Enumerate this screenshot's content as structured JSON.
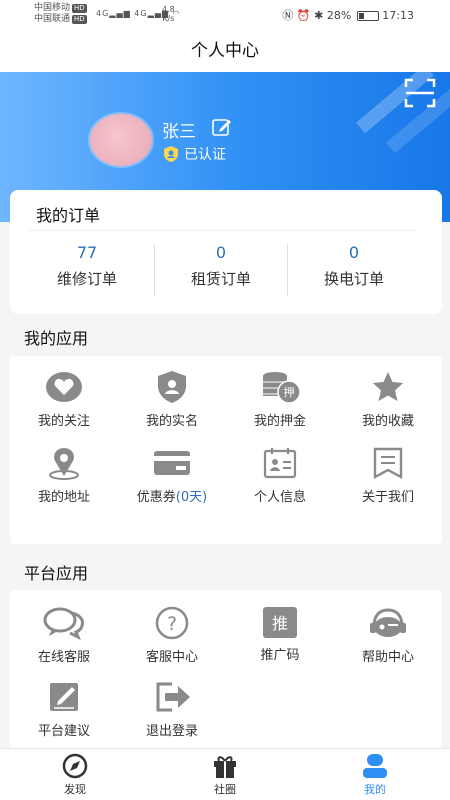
{
  "status_bar": {
    "carrier1": "中国移动",
    "carrier2": "中国联通",
    "hd": "HD",
    "network": "4G",
    "speed_value": "4.8",
    "speed_unit": "K/s",
    "battery": "28%",
    "time": "17:13"
  },
  "title": "个人中心",
  "user": {
    "name": "张三",
    "verified": "已认证"
  },
  "orders": {
    "title": "我的订单",
    "items": [
      {
        "count": "77",
        "label": "维修订单"
      },
      {
        "count": "0",
        "label": "租赁订单"
      },
      {
        "count": "0",
        "label": "换电订单"
      }
    ]
  },
  "my_apps": {
    "title": "我的应用",
    "items": [
      {
        "label": "我的关注",
        "icon": "heart-icon"
      },
      {
        "label": "我的实名",
        "icon": "id-shield-icon"
      },
      {
        "label": "我的押金",
        "icon": "deposit-coins-icon",
        "badge": "押"
      },
      {
        "label": "我的收藏",
        "icon": "star-icon"
      },
      {
        "label": "我的地址",
        "icon": "location-pin-icon"
      },
      {
        "label": "优惠券",
        "label_suffix": "(0天)",
        "icon": "card-icon"
      },
      {
        "label": "个人信息",
        "icon": "profile-card-icon"
      },
      {
        "label": "关于我们",
        "icon": "about-book-icon"
      }
    ]
  },
  "platform_apps": {
    "title": "平台应用",
    "items": [
      {
        "label": "在线客服",
        "icon": "chat-bubbles-icon"
      },
      {
        "label": "客服中心",
        "icon": "question-circle-icon"
      },
      {
        "label": "推广码",
        "icon": "promo-code-icon",
        "badge": "推"
      },
      {
        "label": "帮助中心",
        "icon": "headset-icon"
      },
      {
        "label": "平台建议",
        "icon": "suggestion-edit-icon"
      },
      {
        "label": "退出登录",
        "icon": "logout-icon"
      }
    ]
  },
  "tabs": [
    {
      "label": "发现",
      "icon": "discover-icon",
      "active": false
    },
    {
      "label": "社圈",
      "icon": "gift-icon",
      "active": false
    },
    {
      "label": "我的",
      "icon": "user-icon",
      "active": true
    }
  ],
  "colors": {
    "accent": "#2e8ff4",
    "icon_gray": "#8a8a8a",
    "number_blue": "#2b6fb8"
  }
}
